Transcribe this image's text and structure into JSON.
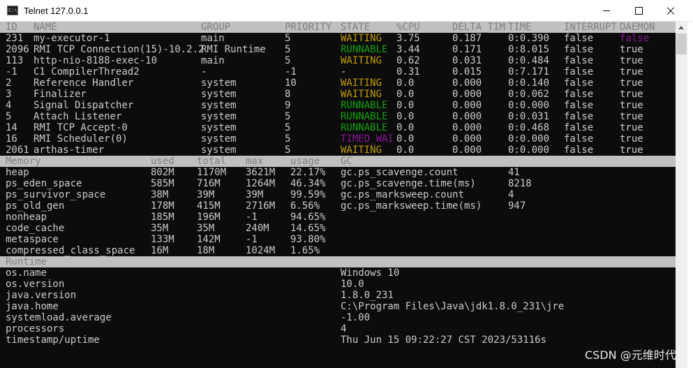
{
  "window": {
    "title": "Telnet 127.0.0.1",
    "icon": "console-window-icon",
    "controls": [
      "minimize-icon",
      "maximize-icon",
      "close-icon"
    ]
  },
  "threads": {
    "headers": [
      "ID",
      "NAME",
      "GROUP",
      "PRIORITY",
      "STATE",
      "%CPU",
      "DELTA_TIM",
      "TIME",
      "INTERRUPT",
      "DAEMON"
    ],
    "rows": [
      [
        "231",
        "my-executor-1",
        "main",
        "5",
        "WAITING",
        "3.75",
        "0.187",
        "0:0.390",
        "false",
        "false"
      ],
      [
        "2096",
        "RMI TCP Connection(15)-10.2.2",
        "RMI Runtime",
        "5",
        "RUNNABLE",
        "3.44",
        "0.171",
        "0:8.015",
        "false",
        "true"
      ],
      [
        "113",
        "http-nio-8188-exec-10",
        "main",
        "5",
        "WAITING",
        "0.62",
        "0.031",
        "0:0.484",
        "false",
        "true"
      ],
      [
        "-1",
        "C1 CompilerThread2",
        "-",
        "-1",
        "-",
        "0.31",
        "0.015",
        "0:7.171",
        "false",
        "true"
      ],
      [
        "2",
        "Reference Handler",
        "system",
        "10",
        "WAITING",
        "0.0",
        "0.000",
        "0:0.140",
        "false",
        "true"
      ],
      [
        "3",
        "Finalizer",
        "system",
        "8",
        "WAITING",
        "0.0",
        "0.000",
        "0:0.062",
        "false",
        "true"
      ],
      [
        "4",
        "Signal Dispatcher",
        "system",
        "9",
        "RUNNABLE",
        "0.0",
        "0.000",
        "0:0.000",
        "false",
        "true"
      ],
      [
        "5",
        "Attach Listener",
        "system",
        "5",
        "RUNNABLE",
        "0.0",
        "0.000",
        "0:0.031",
        "false",
        "true"
      ],
      [
        "14",
        "RMI TCP Accept-0",
        "system",
        "5",
        "RUNNABLE",
        "0.0",
        "0.000",
        "0:0.468",
        "false",
        "true"
      ],
      [
        "16",
        "RMI Scheduler(0)",
        "system",
        "5",
        "TIMED_WAI",
        "0.0",
        "0.000",
        "0:0.000",
        "false",
        "true"
      ],
      [
        "2061",
        "arthas-timer",
        "system",
        "5",
        "WAITING",
        "0.0",
        "0.000",
        "0:0.000",
        "false",
        "true"
      ]
    ],
    "state_kind": [
      "WAITING",
      "RUNNABLE",
      "WAITING",
      "-",
      "WAITING",
      "WAITING",
      "RUNNABLE",
      "RUNNABLE",
      "RUNNABLE",
      "TIMED_WAITING",
      "WAITING"
    ]
  },
  "memory": {
    "headers": [
      "Memory",
      "used",
      "total",
      "max",
      "usage",
      "GC"
    ],
    "rows": [
      [
        "heap",
        "802M",
        "1170M",
        "3621M",
        "22.17%"
      ],
      [
        "ps_eden_space",
        "585M",
        "716M",
        "1264M",
        "46.34%"
      ],
      [
        "ps_survivor_space",
        "38M",
        "39M",
        "39M",
        "99.59%"
      ],
      [
        "ps_old_gen",
        "178M",
        "415M",
        "2716M",
        "6.56%"
      ],
      [
        "nonheap",
        "185M",
        "196M",
        "-1",
        "94.65%"
      ],
      [
        "code_cache",
        "35M",
        "35M",
        "240M",
        "14.65%"
      ],
      [
        "metaspace",
        "133M",
        "142M",
        "-1",
        "93.80%"
      ],
      [
        "compressed_class_space",
        "16M",
        "18M",
        "1024M",
        "1.65%"
      ]
    ],
    "gc": [
      [
        "gc.ps_scavenge.count",
        "41"
      ],
      [
        "gc.ps_scavenge.time(ms)",
        "8218"
      ],
      [
        "gc.ps_marksweep.count",
        "4"
      ],
      [
        "gc.ps_marksweep.time(ms)",
        "947"
      ]
    ]
  },
  "runtime": {
    "header": "Runtime",
    "rows": [
      [
        "os.name",
        "Windows 10"
      ],
      [
        "os.version",
        "10.0"
      ],
      [
        "java.version",
        "1.8.0_231"
      ],
      [
        "java.home",
        "C:\\Program Files\\Java\\jdk1.8.0_231\\jre"
      ],
      [
        "systemload.average",
        "-1.00"
      ],
      [
        "processors",
        "4"
      ],
      [
        "timestamp/uptime",
        "Thu Jun 15 09:22:27 CST 2023/53116s"
      ]
    ]
  },
  "watermark": "CSDN @元维时代",
  "colors": {
    "waiting": "#c19c00",
    "runnable": "#13a10e",
    "timed_waiting": "#881798",
    "header_bg": "#c0c0c0"
  }
}
